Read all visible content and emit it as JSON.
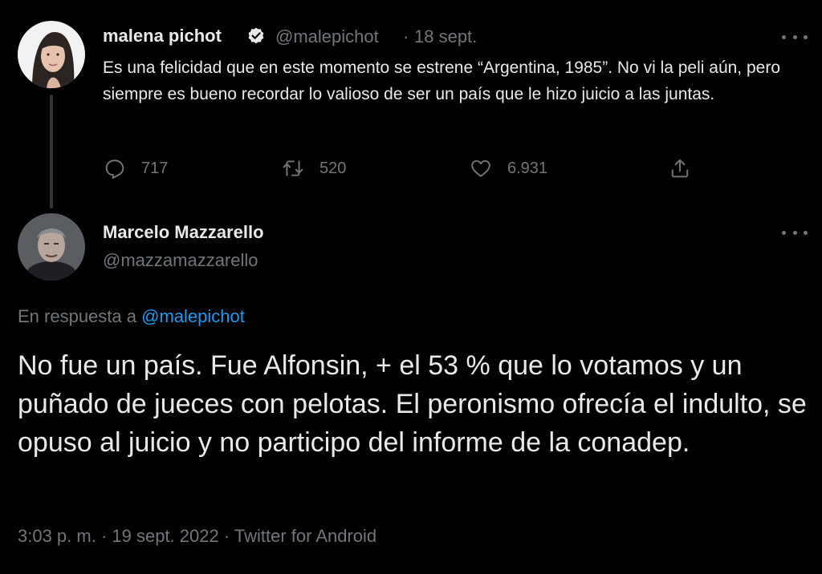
{
  "parent_tweet": {
    "author_name": "malena pichot",
    "handle": "@malepichot",
    "separator": "·",
    "date": "18 sept.",
    "text": "Es una felicidad que en este momento se estrene “Argentina, 1985”. No vi la peli aún, pero siempre es bueno recordar lo valioso de ser un país que le hizo juicio a las juntas.",
    "replies_count": "717",
    "retweets_count": "520",
    "likes_count": "6.931",
    "icons": {
      "reply": "reply-icon",
      "retweet": "retweet-icon",
      "like": "heart-icon",
      "share": "share-icon",
      "verified": "verified-badge-icon",
      "more": "more-options-icon"
    }
  },
  "main_tweet": {
    "author_name": "Marcelo Mazzarello",
    "handle": "@mazzamazzarello",
    "reply_prefix": "En respuesta a",
    "reply_mention": "@malepichot",
    "text": "No fue un país. Fue Alfonsin, + el 53 % que lo votamos y un puñado de jueces con pelotas. El peronismo ofrecía el indulto, se opuso al juicio  y no participo del informe de la conadep.",
    "timestamp": "3:03 p. m. · 19 sept. 2022 · Twitter for Android"
  },
  "colors": {
    "background": "#000000",
    "text_primary": "#e7e9ea",
    "text_secondary": "#71767b",
    "accent": "#1d9bf0"
  }
}
